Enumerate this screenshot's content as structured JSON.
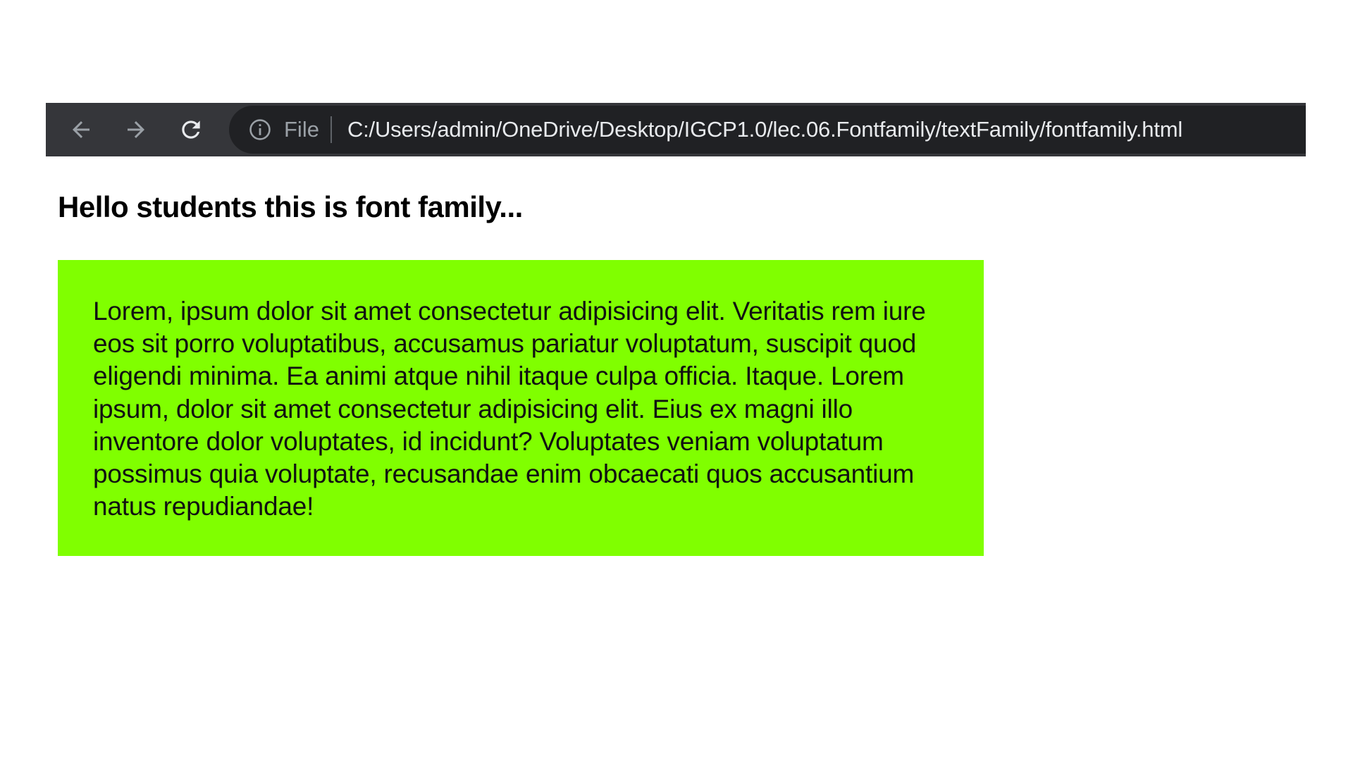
{
  "browser": {
    "nav": {
      "back_icon": "arrow-left-icon",
      "forward_icon": "arrow-right-icon",
      "reload_icon": "reload-icon"
    },
    "omnibox": {
      "info_icon": "info-circle-icon",
      "scheme_label": "File",
      "url": "C:/Users/admin/OneDrive/Desktop/IGCP1.0/lec.06.Fontfamily/textFamily/fontfamily.html"
    },
    "colors": {
      "toolbar_bg": "#35363a",
      "omnibox_bg": "#202124",
      "icon": "#9aa0a6"
    }
  },
  "page": {
    "heading": "Hello students this is font family...",
    "lorem": "Lorem, ipsum dolor sit amet consectetur adipisicing elit. Veritatis rem iure eos sit porro voluptatibus, accusamus pariatur voluptatum, suscipit quod eligendi minima. Ea animi atque nihil itaque culpa officia. Itaque. Lorem ipsum, dolor sit amet consectetur adipisicing elit. Eius ex magni illo inventore dolor voluptates, id incidunt? Voluptates veniam voluptatum possimus quia voluptate, recusandae enim obcaecati quos accusantium natus repudiandae!",
    "colors": {
      "box_bg": "#80ff00",
      "text": "#111111"
    }
  }
}
